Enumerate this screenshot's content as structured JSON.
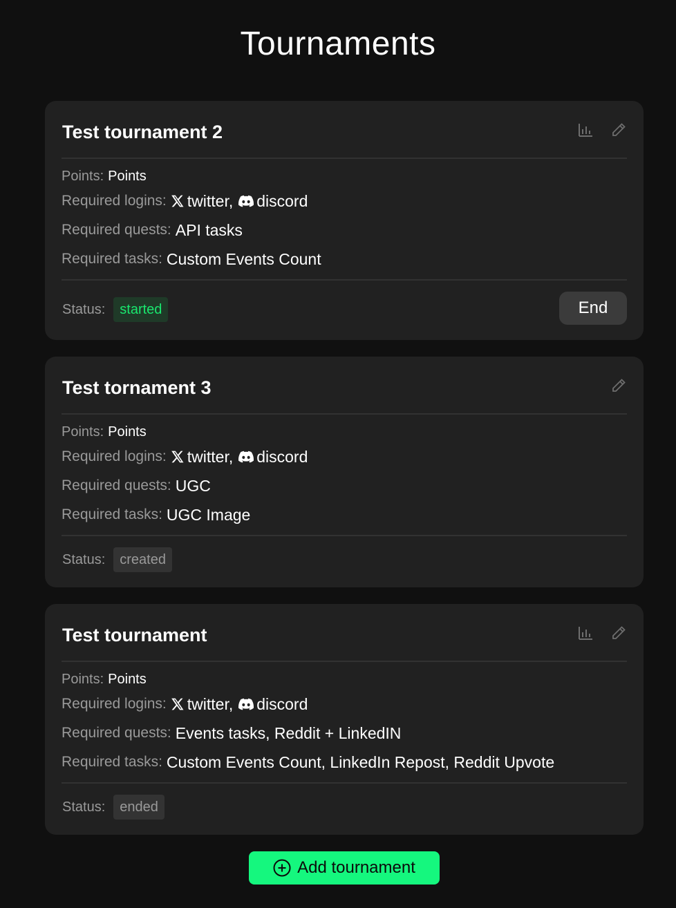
{
  "page": {
    "title": "Tournaments"
  },
  "tournaments": [
    {
      "name": "Test tournament 2",
      "points_label": "Points:",
      "points": "Points",
      "logins_label": "Required logins:",
      "logins": [
        "twitter,",
        "discord"
      ],
      "quests_label": "Required quests:",
      "quests": "API tasks",
      "tasks_label": "Required tasks:",
      "tasks": "Custom Events Count",
      "status_label": "Status:",
      "status": "started",
      "end_label": "End"
    },
    {
      "name": "Test tornament 3",
      "points_label": "Points:",
      "points": "Points",
      "logins_label": "Required logins:",
      "logins": [
        "twitter,",
        "discord"
      ],
      "quests_label": "Required quests:",
      "quests": "UGC",
      "tasks_label": "Required tasks:",
      "tasks": "UGC Image",
      "status_label": "Status:",
      "status": "created"
    },
    {
      "name": "Test tournament",
      "points_label": "Points:",
      "points": "Points",
      "logins_label": "Required logins:",
      "logins": [
        "twitter,",
        "discord"
      ],
      "quests_label": "Required quests:",
      "quests": "Events tasks, Reddit + LinkedIN",
      "tasks_label": "Required tasks:",
      "tasks": "Custom Events Count, LinkedIn Repost, Reddit Upvote",
      "status_label": "Status:",
      "status": "ended"
    }
  ],
  "add_button_label": "Add tournament",
  "icons": {
    "leaderboard": "bar-chart-icon",
    "edit": "pencil-icon",
    "twitter": "x-logo-icon",
    "discord": "discord-logo-icon",
    "add": "plus-circle-icon"
  },
  "colors": {
    "background": "#101010",
    "card": "#212121",
    "accent": "#15f77e",
    "status_started_text": "#19e86e",
    "status_started_bg": "#1f3a28",
    "muted_text": "#9a9a9a"
  }
}
